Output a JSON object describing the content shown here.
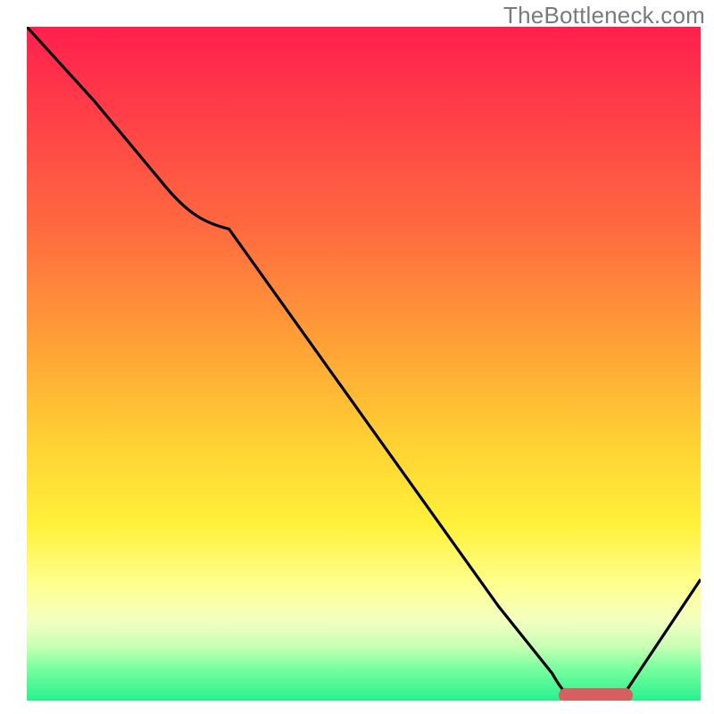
{
  "source_site": "TheBottleneck.com",
  "colors": {
    "gradient_top": "#ff1f4e",
    "gradient_mid_orange": "#ffa436",
    "gradient_mid_yellow": "#fff13a",
    "gradient_bottom": "#27f08d",
    "curve": "#000000",
    "marker": "#d66060",
    "watermark_text": "#7a7a7a"
  },
  "chart_data": {
    "type": "line",
    "title": "",
    "xlabel": "",
    "ylabel": "",
    "xlim": [
      0,
      100
    ],
    "ylim": [
      0,
      100
    ],
    "grid": false,
    "legend": false,
    "background_gradient": "red_to_green_vertical",
    "series": [
      {
        "name": "bottleneck-curve",
        "x": [
          0,
          10,
          20,
          30,
          40,
          50,
          60,
          70,
          78,
          82,
          88,
          100
        ],
        "y": [
          100,
          89,
          77,
          70,
          56,
          42,
          28,
          14,
          4,
          0,
          0,
          18
        ]
      }
    ],
    "marker": {
      "name": "optimal-range-marker",
      "x_start": 79,
      "x_end": 90,
      "y": 0
    }
  }
}
